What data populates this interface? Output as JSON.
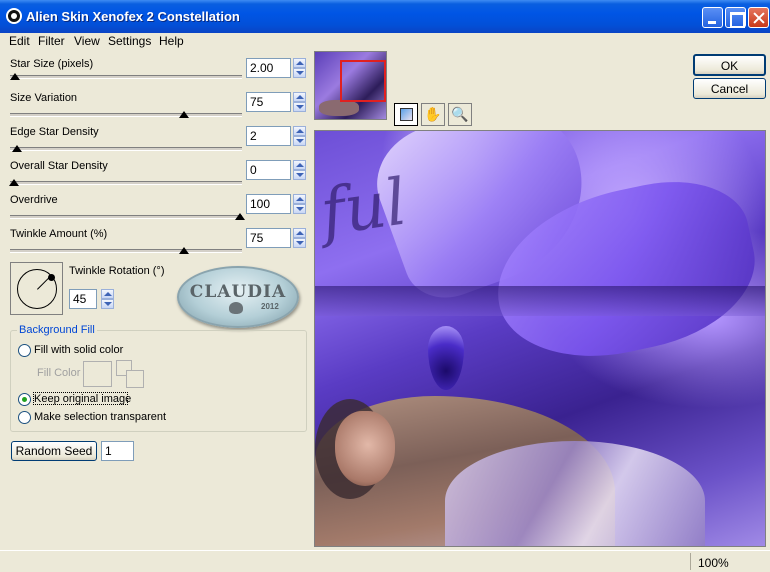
{
  "window": {
    "title": "Alien Skin Xenofex 2 Constellation"
  },
  "menu": [
    "Edit",
    "Filter",
    "View",
    "Settings",
    "Help"
  ],
  "params": [
    {
      "label": "Star Size (pixels)",
      "value": "2.00"
    },
    {
      "label": "Size Variation",
      "value": "75"
    },
    {
      "label": "Edge Star Density",
      "value": "2"
    },
    {
      "label": "Overall Star Density",
      "value": "0"
    },
    {
      "label": "Overdrive",
      "value": "100"
    },
    {
      "label": "Twinkle Amount (%)",
      "value": "75"
    }
  ],
  "twinkle_rotation": {
    "label": "Twinkle Rotation (°)",
    "value": "45"
  },
  "watermark": {
    "text": "CLAUDIA",
    "year": "2012"
  },
  "background_fill": {
    "legend": "Background Fill",
    "options": [
      "Fill with solid color",
      "Keep original image",
      "Make selection transparent"
    ],
    "selected": "Keep original image",
    "fill_color_label": "Fill Color"
  },
  "random_seed": {
    "label": "Random Seed",
    "value": "1"
  },
  "buttons": {
    "ok": "OK",
    "cancel": "Cancel"
  },
  "preview": {
    "script_text": "ful"
  },
  "status": {
    "zoom": "100%"
  }
}
